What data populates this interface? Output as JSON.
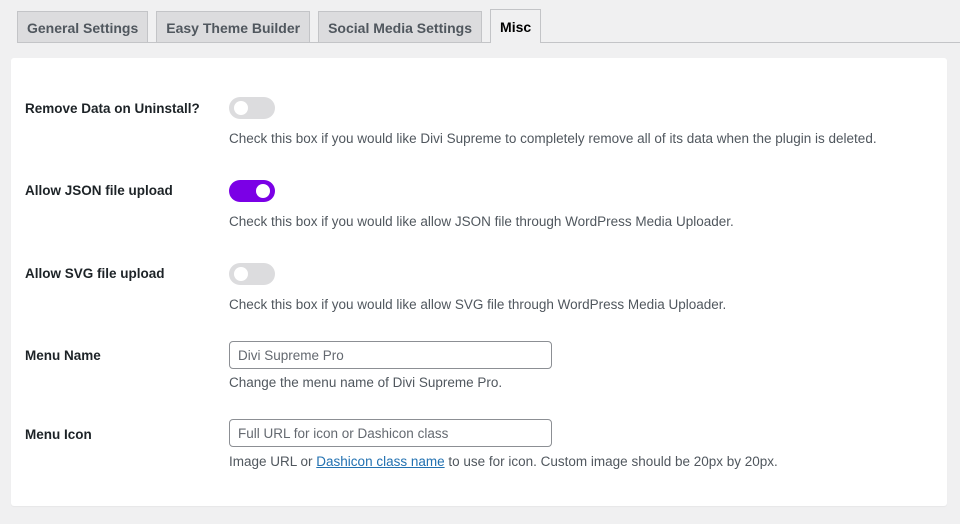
{
  "tabs": [
    {
      "label": "General Settings",
      "active": false
    },
    {
      "label": "Easy Theme Builder",
      "active": false
    },
    {
      "label": "Social Media Settings",
      "active": false
    },
    {
      "label": "Misc",
      "active": true
    }
  ],
  "settings": {
    "remove_data": {
      "label": "Remove Data on Uninstall?",
      "enabled": false,
      "description": "Check this box if you would like Divi Supreme to completely remove all of its data when the plugin is deleted."
    },
    "allow_json": {
      "label": "Allow JSON file upload",
      "enabled": true,
      "description": "Check this box if you would like allow JSON file through WordPress Media Uploader."
    },
    "allow_svg": {
      "label": "Allow SVG file upload",
      "enabled": false,
      "description": "Check this box if you would like allow SVG file through WordPress Media Uploader."
    },
    "menu_name": {
      "label": "Menu Name",
      "value": "",
      "placeholder": "Divi Supreme Pro",
      "description": "Change the menu name of Divi Supreme Pro."
    },
    "menu_icon": {
      "label": "Menu Icon",
      "value": "",
      "placeholder": "Full URL for icon or Dashicon class",
      "description_prefix": "Image URL or ",
      "description_link": "Dashicon class name",
      "description_suffix": " to use for icon. Custom image should be 20px by 20px."
    }
  },
  "colors": {
    "toggle_on": "#7b00e6",
    "toggle_off": "#dcdcde",
    "link": "#2271b1"
  },
  "icons": {
    "toggle_knob": "circle"
  }
}
